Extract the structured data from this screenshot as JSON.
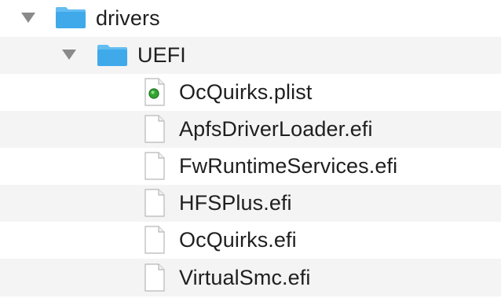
{
  "tree": {
    "folder_drivers": {
      "label": "drivers",
      "expanded": true,
      "icon": "folder-icon"
    },
    "folder_uefi": {
      "label": "UEFI",
      "expanded": true,
      "icon": "folder-icon"
    },
    "files": [
      {
        "label": "OcQuirks.plist",
        "icon": "plist-document-icon"
      },
      {
        "label": "ApfsDriverLoader.efi",
        "icon": "document-icon"
      },
      {
        "label": "FwRuntimeServices.efi",
        "icon": "document-icon"
      },
      {
        "label": "HFSPlus.efi",
        "icon": "document-icon"
      },
      {
        "label": "OcQuirks.efi",
        "icon": "document-icon"
      },
      {
        "label": "VirtualSmc.efi",
        "icon": "document-icon"
      }
    ]
  },
  "colors": {
    "folder": "#3fa9ea",
    "folder_tab": "#63bdf1",
    "row_alt": "#f4f4f5",
    "plist_dot": "#33a532"
  }
}
